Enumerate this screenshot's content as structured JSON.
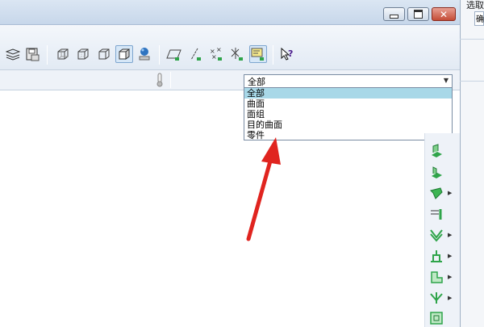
{
  "titlebar": {
    "min_icon": "minimize-icon",
    "max_icon": "maximize-icon",
    "close_icon": "close-icon"
  },
  "side_panel": {
    "label": "选取",
    "box_text": "确"
  },
  "toolbar": {
    "buttons": [
      "layers-icon",
      "save-view-icon",
      "wireframe-box-icon",
      "hidden-line-box-icon",
      "no-hidden-box-icon",
      "shaded-box-icon",
      "appearance-icon",
      "plane-display-icon",
      "axis-display-icon",
      "point-display-icon",
      "csys-display-icon",
      "annotation-display-icon",
      "help-icon"
    ]
  },
  "filter": {
    "selected": "全部",
    "options": [
      "全部",
      "曲面",
      "面组",
      "目的曲面",
      "零件"
    ]
  },
  "right_toolbar": {
    "buttons": [
      "extrude-icon",
      "revolve-icon",
      "sweep-icon",
      "datum-icon",
      "round-icon",
      "shell-icon",
      "rib-icon",
      "draft-icon",
      "pattern-icon"
    ]
  },
  "colors": {
    "accent_green": "#2fa44a",
    "annotation_red": "#e0241f",
    "selection": "#a8d8e8"
  }
}
